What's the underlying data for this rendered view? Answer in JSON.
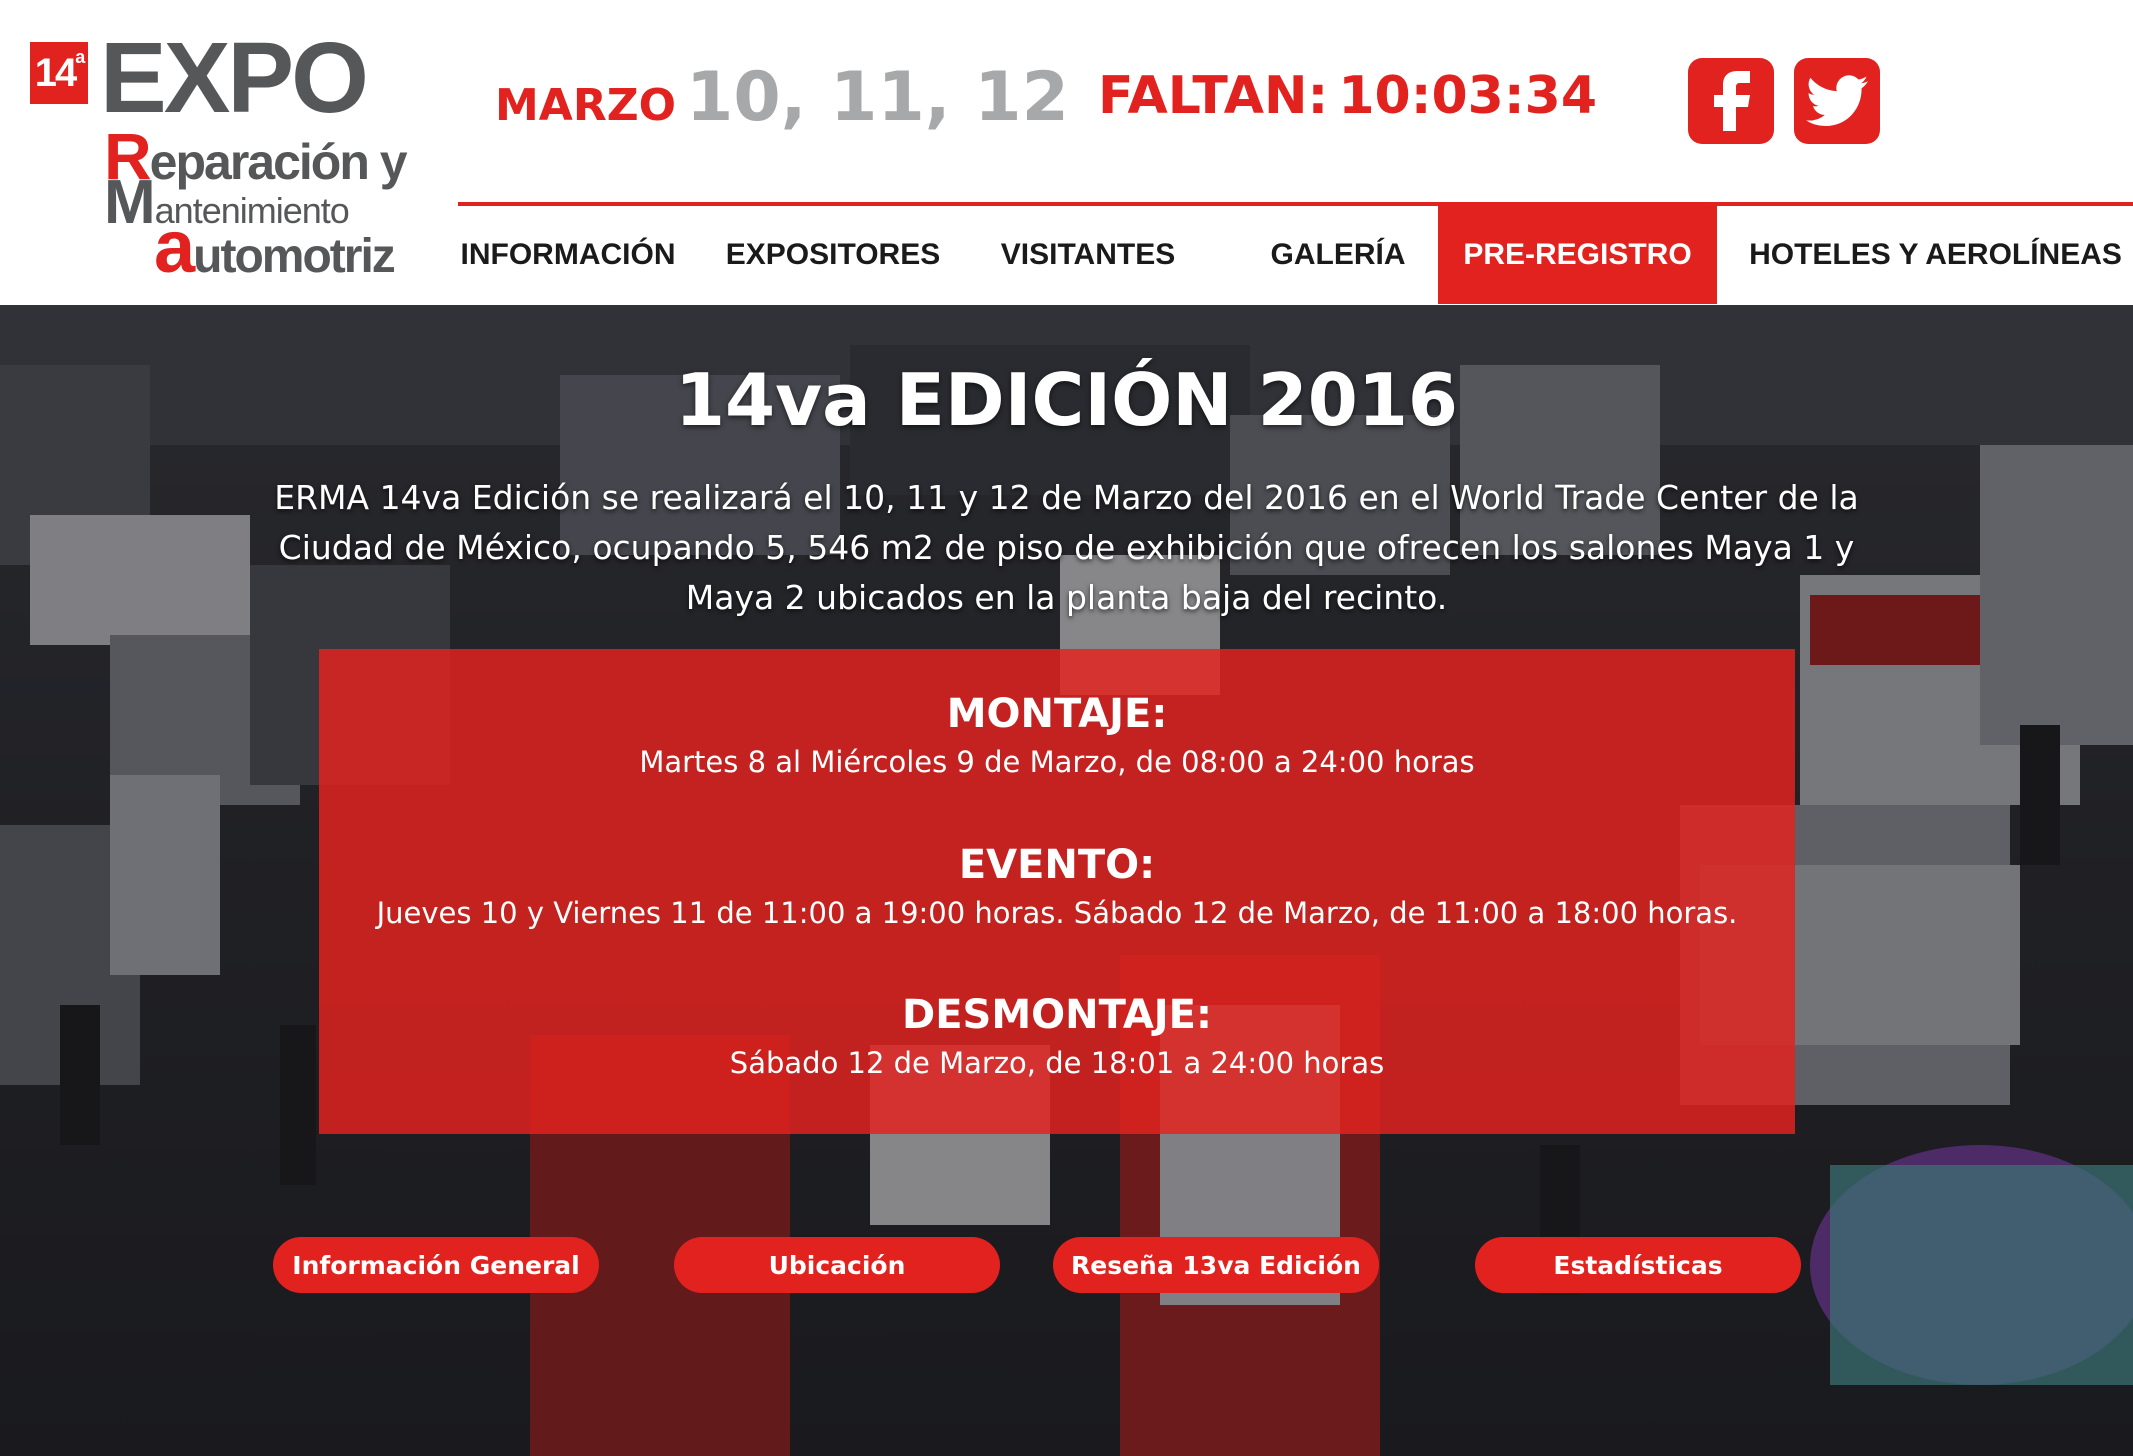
{
  "logo": {
    "badge": "14",
    "badge_sup": "a",
    "expo": "EXPO",
    "line1_cap": "R",
    "line1_rest": "eparación y",
    "line2_cap": "M",
    "line2_rest": "antenimiento",
    "line3_cap": "a",
    "line3_rest": "utomotriz"
  },
  "header": {
    "month": "MARZO",
    "days": "10, 11, 12",
    "countdown_label": "FALTAN:",
    "countdown_time": "10:03:34"
  },
  "social": [
    {
      "icon": "facebook-icon"
    },
    {
      "icon": "twitter-icon"
    }
  ],
  "nav": {
    "items": [
      {
        "label": "INFORMACIÓN"
      },
      {
        "label": "EXPOSITORES"
      },
      {
        "label": "VISITANTES"
      },
      {
        "label": "GALERÍA"
      },
      {
        "label": "PRE-REGISTRO",
        "active": true
      },
      {
        "label": "HOTELES Y AEROLÍNEAS"
      }
    ]
  },
  "hero": {
    "title": "14va EDICIÓN 2016",
    "description": "ERMA 14va Edición se realizará el 10, 11 y 12 de Marzo del 2016 en el World Trade Center de la Ciudad de México, ocupando 5, 546 m2 de piso de exhibición que ofrecen los salones Maya 1 y Maya 2 ubicados en la planta baja del recinto.",
    "schedule": [
      {
        "heading": "MONTAJE:",
        "text": "Martes 8 al Miércoles 9 de Marzo, de 08:00 a 24:00 horas"
      },
      {
        "heading": "EVENTO:",
        "text": "Jueves 10 y Viernes 11 de 11:00 a 19:00 horas. Sábado 12 de Marzo, de 11:00 a 18:00 horas."
      },
      {
        "heading": "DESMONTAJE:",
        "text": "Sábado 12 de Marzo, de 18:01 a 24:00 horas"
      }
    ],
    "buttons": [
      {
        "label": "Información General"
      },
      {
        "label": "Ubicación"
      },
      {
        "label": "Reseña 13va Edición"
      },
      {
        "label": "Estadísticas"
      }
    ]
  },
  "colors": {
    "brand_red": "#e2221f",
    "logo_gray": "#555759",
    "date_gray": "#a7a8aa"
  }
}
